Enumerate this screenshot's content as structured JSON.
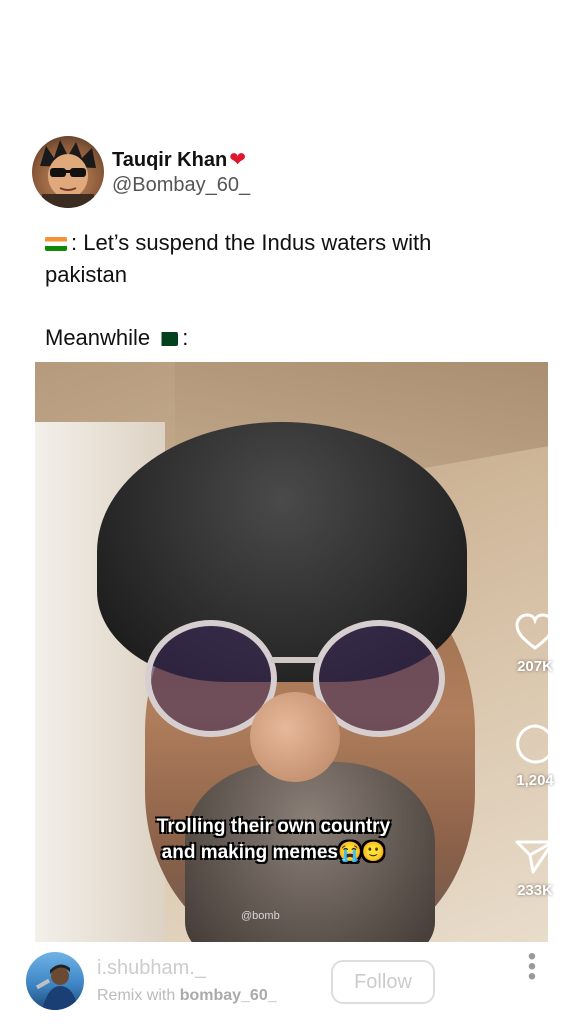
{
  "tweet": {
    "display_name": "Tauqir Khan",
    "handle": "@Bombay_60_",
    "line1": ": Let’s suspend the Indus waters with",
    "line2": "pakistan",
    "line3_prefix": "Meanwhile",
    "line3_suffix": ":",
    "icons": {
      "heart": "heart-icon",
      "flag_india": "india-flag-icon",
      "flag_pakistan": "pakistan-flag-icon"
    }
  },
  "video": {
    "caption_line1": "Trolling their own country",
    "caption_line2": "and making memes😭🙂",
    "watermark": "@bomb"
  },
  "actions": {
    "likes": "207K",
    "comments": "1,204",
    "shares": "233K"
  },
  "reel": {
    "username": "i.shubham._",
    "remix_prefix": "Remix with ",
    "remix_user": "bombay_60_",
    "follow_label": "Follow"
  },
  "colors": {
    "heart": "#e0162b",
    "text": "#111111"
  }
}
